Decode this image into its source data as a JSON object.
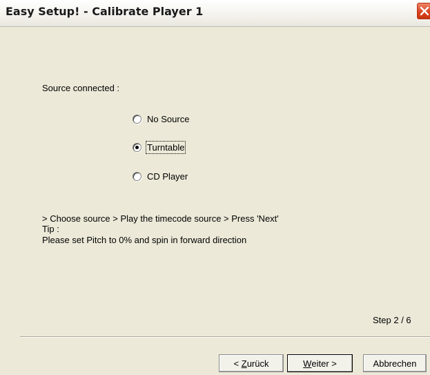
{
  "window": {
    "title": "Easy Setup! - Calibrate Player 1"
  },
  "form": {
    "source_label": "Source connected :",
    "options": [
      {
        "label": "No Source",
        "checked": false
      },
      {
        "label": "Turntable",
        "checked": true
      },
      {
        "label": "CD Player",
        "checked": false
      }
    ],
    "instructions": "> Choose source > Play the timecode source > Press 'Next'",
    "tip_label": "Tip :",
    "tip_text": "Please set Pitch to 0% and spin in forward direction",
    "step": "Step 2 / 6"
  },
  "buttons": {
    "back_prefix": "< ",
    "back_access": "Z",
    "back_rest": "urück",
    "next_access": "W",
    "next_rest": "eiter >",
    "cancel": "Abbrechen"
  },
  "icons": {
    "close": "close-icon"
  },
  "colors": {
    "dialog_bg": "#ece9d8",
    "close_button": "#d8401c"
  }
}
